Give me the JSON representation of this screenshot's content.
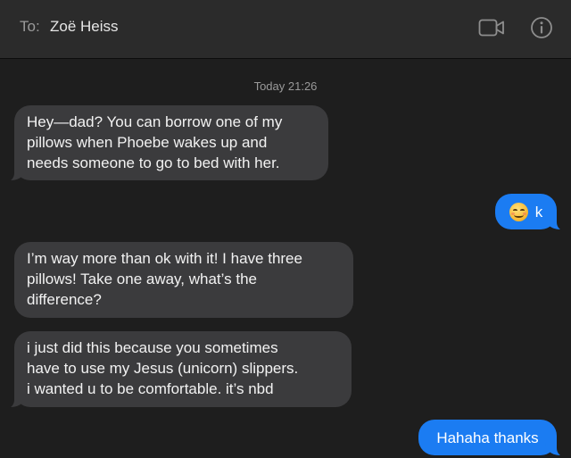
{
  "header": {
    "to_label": "To:",
    "recipient": "Zoë Heiss",
    "video_icon": "video-camera-icon",
    "info_icon": "info-icon"
  },
  "conversation": {
    "timestamp": "Today 21:26",
    "messages": [
      {
        "direction": "incoming",
        "text": "Hey—dad? You can borrow one of my\npillows when Phoebe wakes up and\nneeds someone to go to bed with her."
      },
      {
        "direction": "outgoing",
        "emoji": "smiling-face-icon",
        "text": "k"
      },
      {
        "direction": "incoming",
        "text": "I’m way more than ok with it! I have three\npillows! Take one away, what’s the\ndifference?"
      },
      {
        "direction": "incoming",
        "text": "i just did this because you sometimes\nhave to use my Jesus (unicorn) slippers.\ni wanted u to be comfortable. it’s nbd"
      },
      {
        "direction": "outgoing",
        "text": "Hahaha thanks"
      }
    ]
  },
  "colors": {
    "background": "#1e1e1e",
    "header": "#2b2b2b",
    "incoming_bubble": "#3b3b3d",
    "outgoing_bubble": "#1b7cf2"
  }
}
